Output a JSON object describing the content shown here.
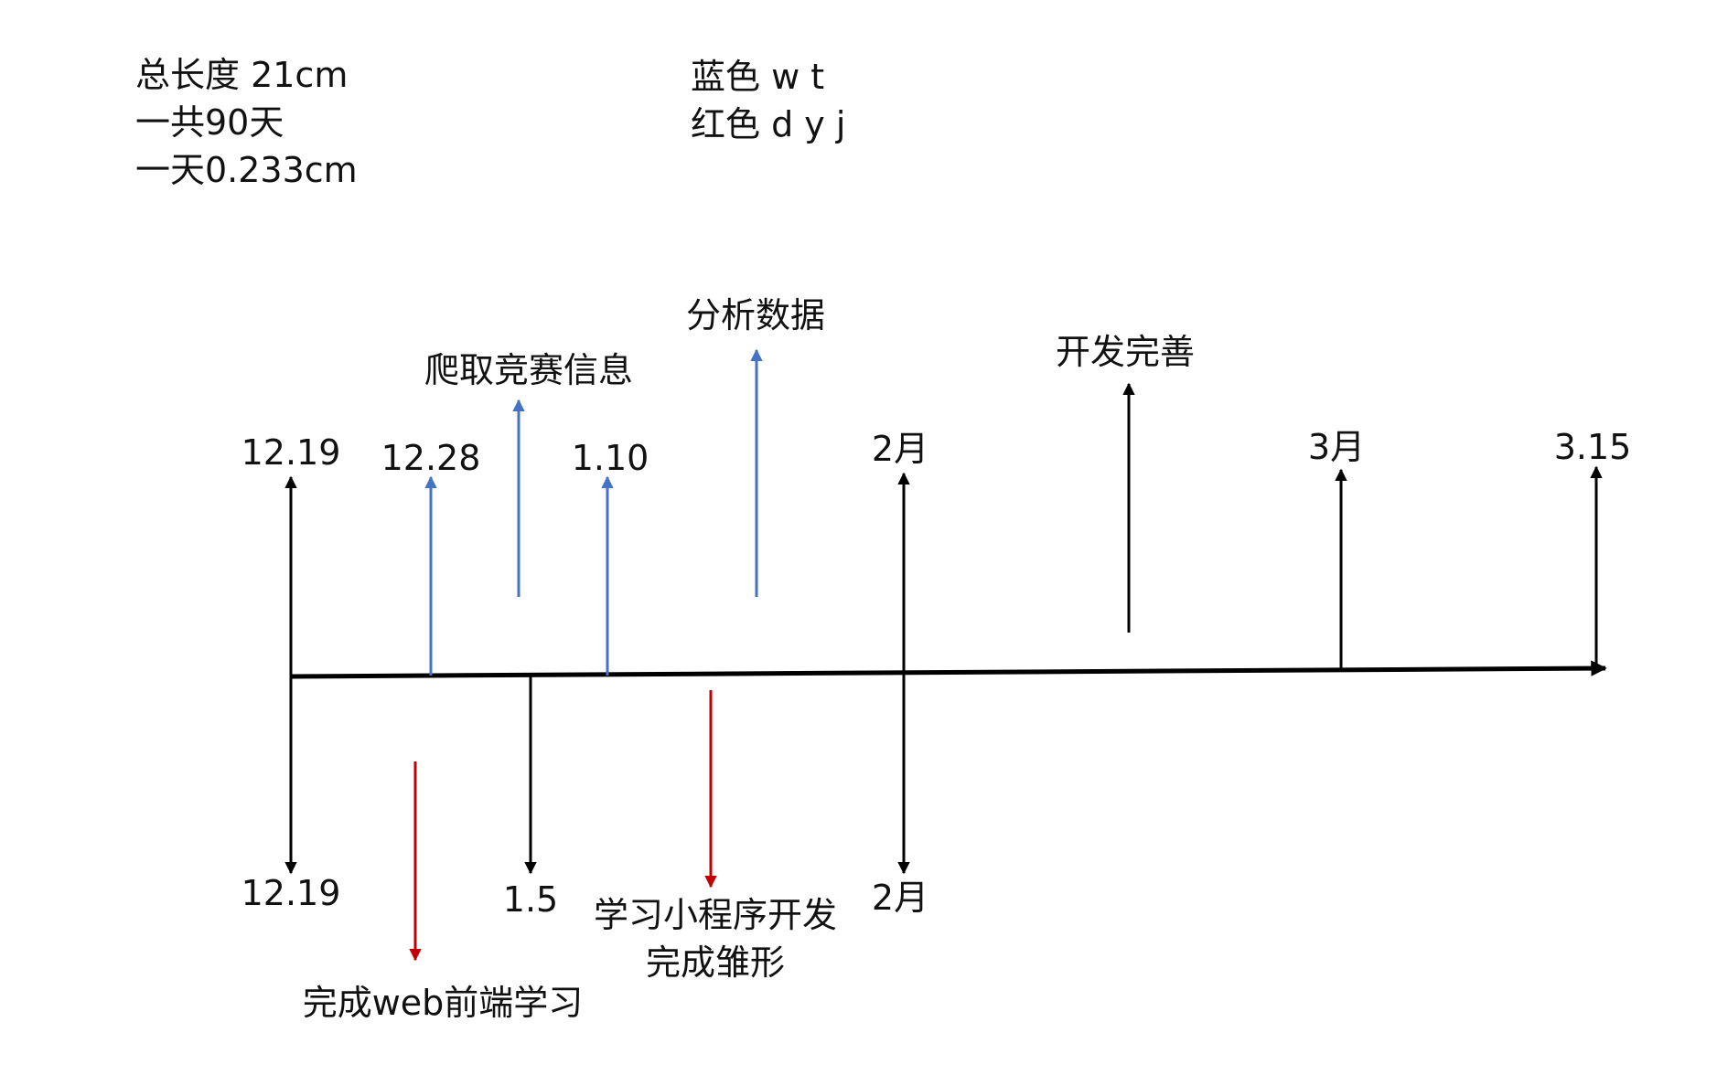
{
  "notes_left": [
    "总长度 21cm",
    "一共90天",
    "一天0.233cm"
  ],
  "legend": [
    "蓝色 w t",
    "红色 d y j"
  ],
  "colors": {
    "axis": "#000000",
    "blue": "#4472c4",
    "red": "#c00000",
    "black": "#000000",
    "text": "#111111"
  },
  "above_dates": [
    "12.19",
    "12.28",
    "1.10",
    "2月",
    "3月",
    "3.15"
  ],
  "above_tasks": [
    "爬取竞赛信息",
    "分析数据",
    "开发完善"
  ],
  "below_dates": [
    "12.19",
    "1.5",
    "2月"
  ],
  "below_tasks": [
    "完成web前端学习",
    "学习小程序开发",
    "完成雏形"
  ]
}
